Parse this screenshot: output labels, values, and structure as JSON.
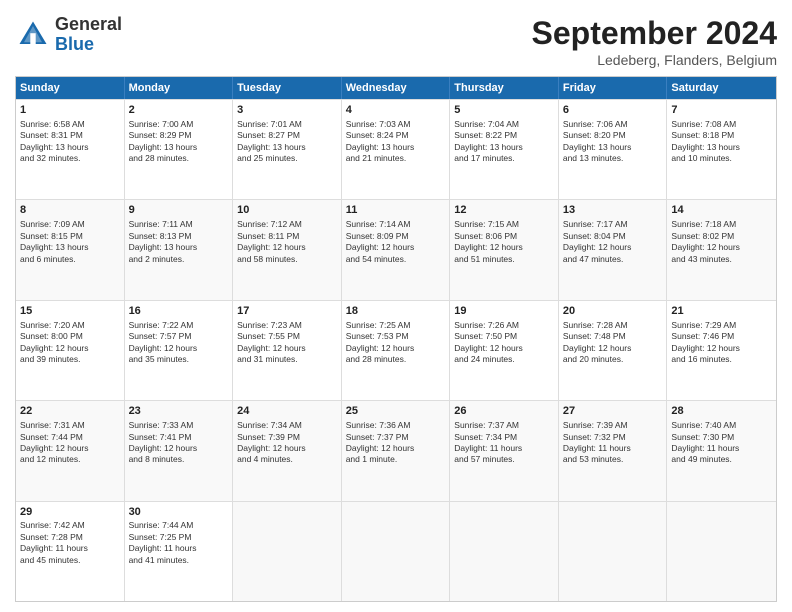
{
  "logo": {
    "general": "General",
    "blue": "Blue"
  },
  "title": "September 2024",
  "location": "Ledeberg, Flanders, Belgium",
  "weekdays": [
    "Sunday",
    "Monday",
    "Tuesday",
    "Wednesday",
    "Thursday",
    "Friday",
    "Saturday"
  ],
  "rows": [
    [
      {
        "day": "",
        "info": ""
      },
      {
        "day": "2",
        "info": "Sunrise: 7:00 AM\nSunset: 8:29 PM\nDaylight: 13 hours\nand 28 minutes."
      },
      {
        "day": "3",
        "info": "Sunrise: 7:01 AM\nSunset: 8:27 PM\nDaylight: 13 hours\nand 25 minutes."
      },
      {
        "day": "4",
        "info": "Sunrise: 7:03 AM\nSunset: 8:24 PM\nDaylight: 13 hours\nand 21 minutes."
      },
      {
        "day": "5",
        "info": "Sunrise: 7:04 AM\nSunset: 8:22 PM\nDaylight: 13 hours\nand 17 minutes."
      },
      {
        "day": "6",
        "info": "Sunrise: 7:06 AM\nSunset: 8:20 PM\nDaylight: 13 hours\nand 13 minutes."
      },
      {
        "day": "7",
        "info": "Sunrise: 7:08 AM\nSunset: 8:18 PM\nDaylight: 13 hours\nand 10 minutes."
      }
    ],
    [
      {
        "day": "8",
        "info": "Sunrise: 7:09 AM\nSunset: 8:15 PM\nDaylight: 13 hours\nand 6 minutes."
      },
      {
        "day": "9",
        "info": "Sunrise: 7:11 AM\nSunset: 8:13 PM\nDaylight: 13 hours\nand 2 minutes."
      },
      {
        "day": "10",
        "info": "Sunrise: 7:12 AM\nSunset: 8:11 PM\nDaylight: 12 hours\nand 58 minutes."
      },
      {
        "day": "11",
        "info": "Sunrise: 7:14 AM\nSunset: 8:09 PM\nDaylight: 12 hours\nand 54 minutes."
      },
      {
        "day": "12",
        "info": "Sunrise: 7:15 AM\nSunset: 8:06 PM\nDaylight: 12 hours\nand 51 minutes."
      },
      {
        "day": "13",
        "info": "Sunrise: 7:17 AM\nSunset: 8:04 PM\nDaylight: 12 hours\nand 47 minutes."
      },
      {
        "day": "14",
        "info": "Sunrise: 7:18 AM\nSunset: 8:02 PM\nDaylight: 12 hours\nand 43 minutes."
      }
    ],
    [
      {
        "day": "15",
        "info": "Sunrise: 7:20 AM\nSunset: 8:00 PM\nDaylight: 12 hours\nand 39 minutes."
      },
      {
        "day": "16",
        "info": "Sunrise: 7:22 AM\nSunset: 7:57 PM\nDaylight: 12 hours\nand 35 minutes."
      },
      {
        "day": "17",
        "info": "Sunrise: 7:23 AM\nSunset: 7:55 PM\nDaylight: 12 hours\nand 31 minutes."
      },
      {
        "day": "18",
        "info": "Sunrise: 7:25 AM\nSunset: 7:53 PM\nDaylight: 12 hours\nand 28 minutes."
      },
      {
        "day": "19",
        "info": "Sunrise: 7:26 AM\nSunset: 7:50 PM\nDaylight: 12 hours\nand 24 minutes."
      },
      {
        "day": "20",
        "info": "Sunrise: 7:28 AM\nSunset: 7:48 PM\nDaylight: 12 hours\nand 20 minutes."
      },
      {
        "day": "21",
        "info": "Sunrise: 7:29 AM\nSunset: 7:46 PM\nDaylight: 12 hours\nand 16 minutes."
      }
    ],
    [
      {
        "day": "22",
        "info": "Sunrise: 7:31 AM\nSunset: 7:44 PM\nDaylight: 12 hours\nand 12 minutes."
      },
      {
        "day": "23",
        "info": "Sunrise: 7:33 AM\nSunset: 7:41 PM\nDaylight: 12 hours\nand 8 minutes."
      },
      {
        "day": "24",
        "info": "Sunrise: 7:34 AM\nSunset: 7:39 PM\nDaylight: 12 hours\nand 4 minutes."
      },
      {
        "day": "25",
        "info": "Sunrise: 7:36 AM\nSunset: 7:37 PM\nDaylight: 12 hours\nand 1 minute."
      },
      {
        "day": "26",
        "info": "Sunrise: 7:37 AM\nSunset: 7:34 PM\nDaylight: 11 hours\nand 57 minutes."
      },
      {
        "day": "27",
        "info": "Sunrise: 7:39 AM\nSunset: 7:32 PM\nDaylight: 11 hours\nand 53 minutes."
      },
      {
        "day": "28",
        "info": "Sunrise: 7:40 AM\nSunset: 7:30 PM\nDaylight: 11 hours\nand 49 minutes."
      }
    ],
    [
      {
        "day": "29",
        "info": "Sunrise: 7:42 AM\nSunset: 7:28 PM\nDaylight: 11 hours\nand 45 minutes."
      },
      {
        "day": "30",
        "info": "Sunrise: 7:44 AM\nSunset: 7:25 PM\nDaylight: 11 hours\nand 41 minutes."
      },
      {
        "day": "",
        "info": ""
      },
      {
        "day": "",
        "info": ""
      },
      {
        "day": "",
        "info": ""
      },
      {
        "day": "",
        "info": ""
      },
      {
        "day": "",
        "info": ""
      }
    ]
  ],
  "row1_day1": {
    "day": "1",
    "info": "Sunrise: 6:58 AM\nSunset: 8:31 PM\nDaylight: 13 hours\nand 32 minutes."
  }
}
